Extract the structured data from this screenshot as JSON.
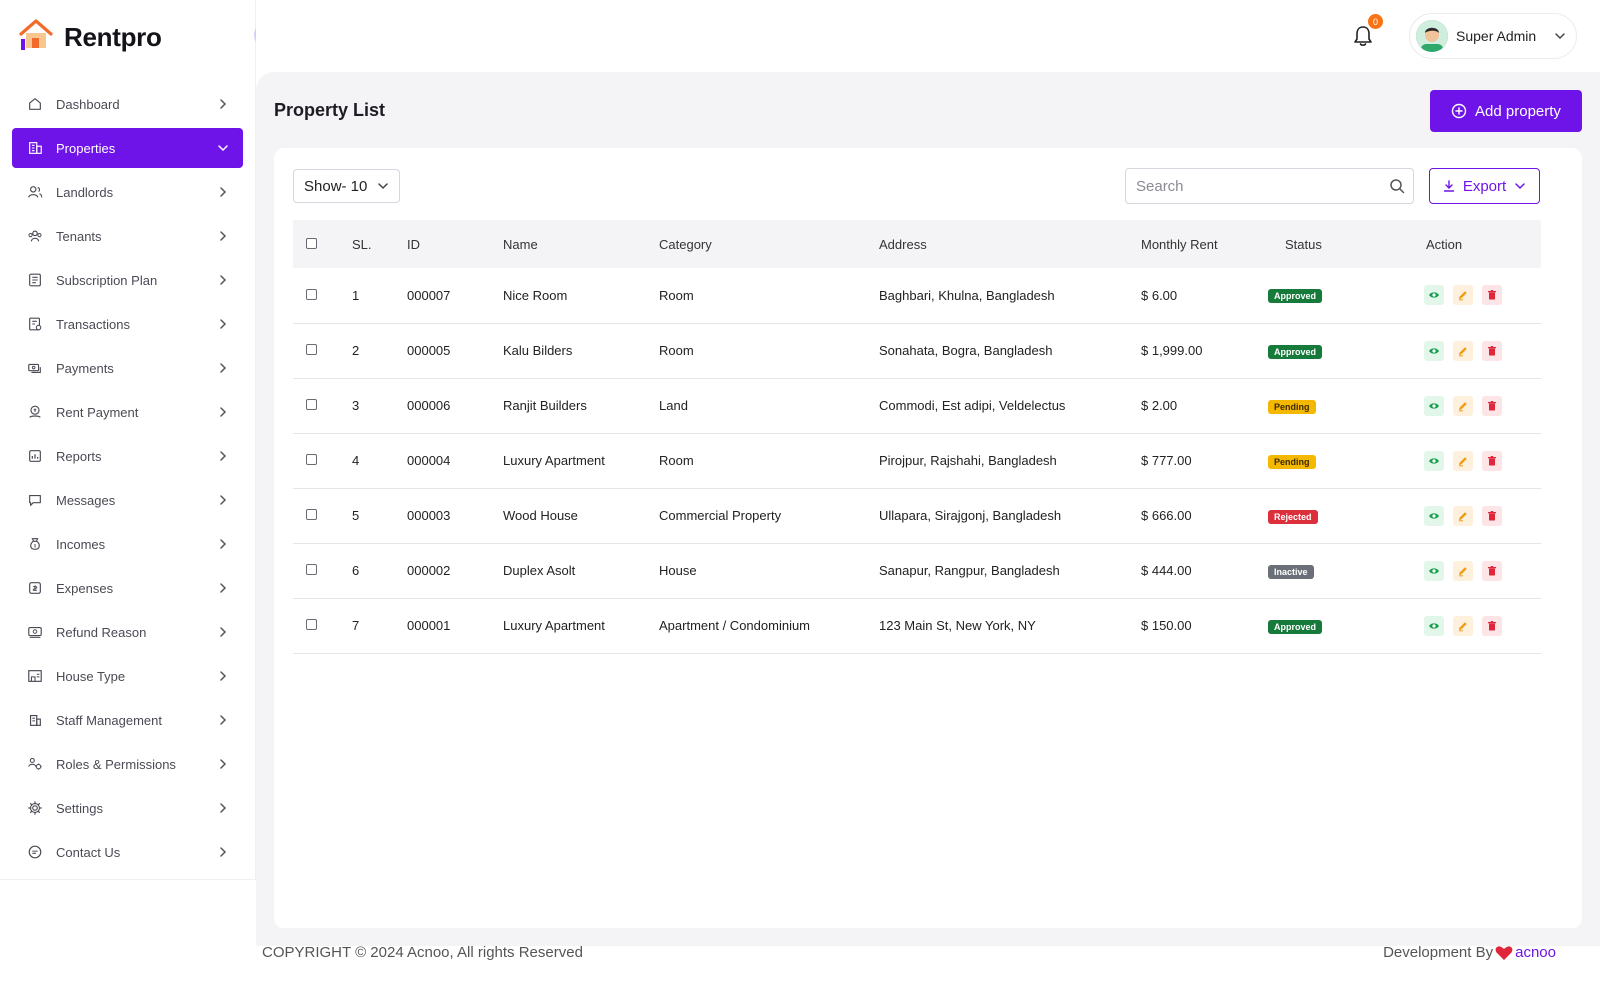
{
  "brand": {
    "name": "Rentpro",
    "logo_icon": "house-logo-icon"
  },
  "sidebar": {
    "items": [
      {
        "label": "Dashboard",
        "icon": "home-icon",
        "active": false
      },
      {
        "label": "Properties",
        "icon": "building-icon",
        "active": true
      },
      {
        "label": "Landlords",
        "icon": "users-icon",
        "active": false
      },
      {
        "label": "Tenants",
        "icon": "group-icon",
        "active": false
      },
      {
        "label": "Subscription Plan",
        "icon": "plan-icon",
        "active": false
      },
      {
        "label": "Transactions",
        "icon": "transactions-icon",
        "active": false
      },
      {
        "label": "Payments",
        "icon": "payments-icon",
        "active": false
      },
      {
        "label": "Rent Payment",
        "icon": "rent-payment-icon",
        "active": false
      },
      {
        "label": "Reports",
        "icon": "reports-icon",
        "active": false
      },
      {
        "label": "Messages",
        "icon": "message-icon",
        "active": false
      },
      {
        "label": "Incomes",
        "icon": "income-icon",
        "active": false
      },
      {
        "label": "Expenses",
        "icon": "expense-icon",
        "active": false
      },
      {
        "label": "Refund Reason",
        "icon": "refund-icon",
        "active": false
      },
      {
        "label": "House Type",
        "icon": "house-type-icon",
        "active": false
      },
      {
        "label": "Staff Management",
        "icon": "staff-icon",
        "active": false
      },
      {
        "label": "Roles & Permissions",
        "icon": "roles-icon",
        "active": false
      },
      {
        "label": "Settings",
        "icon": "gear-icon",
        "active": false
      },
      {
        "label": "Contact Us",
        "icon": "contact-icon",
        "active": false
      }
    ]
  },
  "topbar": {
    "notification_count": "0",
    "user_name": "Super Admin"
  },
  "main": {
    "title": "Property List",
    "add_button": "Add property",
    "show_select": "Show- 10",
    "search_placeholder": "Search",
    "export_button": "Export"
  },
  "table": {
    "headers": [
      "SL.",
      "ID",
      "Name",
      "Category",
      "Address",
      "Monthly Rent",
      "Status",
      "Action"
    ],
    "rows": [
      {
        "sl": "1",
        "id": "000007",
        "name": "Nice Room",
        "category": "Room",
        "address": "Baghbari, Khulna, Bangladesh",
        "rent": "$ 6.00",
        "status": "Approved",
        "status_class": "b-approved"
      },
      {
        "sl": "2",
        "id": "000005",
        "name": "Kalu Bilders",
        "category": "Room",
        "address": "Sonahata, Bogra, Bangladesh",
        "rent": "$ 1,999.00",
        "status": "Approved",
        "status_class": "b-approved"
      },
      {
        "sl": "3",
        "id": "000006",
        "name": "Ranjit Builders",
        "category": "Land",
        "address": "Commodi, Est adipi, Veldelectus",
        "rent": "$ 2.00",
        "status": "Pending",
        "status_class": "b-pending"
      },
      {
        "sl": "4",
        "id": "000004",
        "name": "Luxury Apartment",
        "category": "Room",
        "address": "Pirojpur, Rajshahi, Bangladesh",
        "rent": "$ 777.00",
        "status": "Pending",
        "status_class": "b-pending"
      },
      {
        "sl": "5",
        "id": "000003",
        "name": "Wood House",
        "category": "Commercial Property",
        "address": "Ullapara, Sirajgonj, Bangladesh",
        "rent": "$ 666.00",
        "status": "Rejected",
        "status_class": "b-rejected"
      },
      {
        "sl": "6",
        "id": "000002",
        "name": "Duplex Asolt",
        "category": "House",
        "address": "Sanapur, Rangpur, Bangladesh",
        "rent": "$ 444.00",
        "status": "Inactive",
        "status_class": "b-inactive"
      },
      {
        "sl": "7",
        "id": "000001",
        "name": "Luxury Apartment",
        "category": "Apartment / Condominium",
        "address": "123 Main St, New York, NY",
        "rent": "$ 150.00",
        "status": "Approved",
        "status_class": "b-approved"
      }
    ]
  },
  "footer": {
    "copyright": "COPYRIGHT © 2024 Acnoo, All rights Reserved",
    "dev_by": "Development By",
    "dev_brand": "acnoo"
  },
  "colors": {
    "primary": "#6f14e8",
    "approved": "#167a3a",
    "pending": "#f5b800",
    "rejected": "#dc2f3c",
    "inactive": "#6b6f78",
    "notification": "#f97316"
  }
}
